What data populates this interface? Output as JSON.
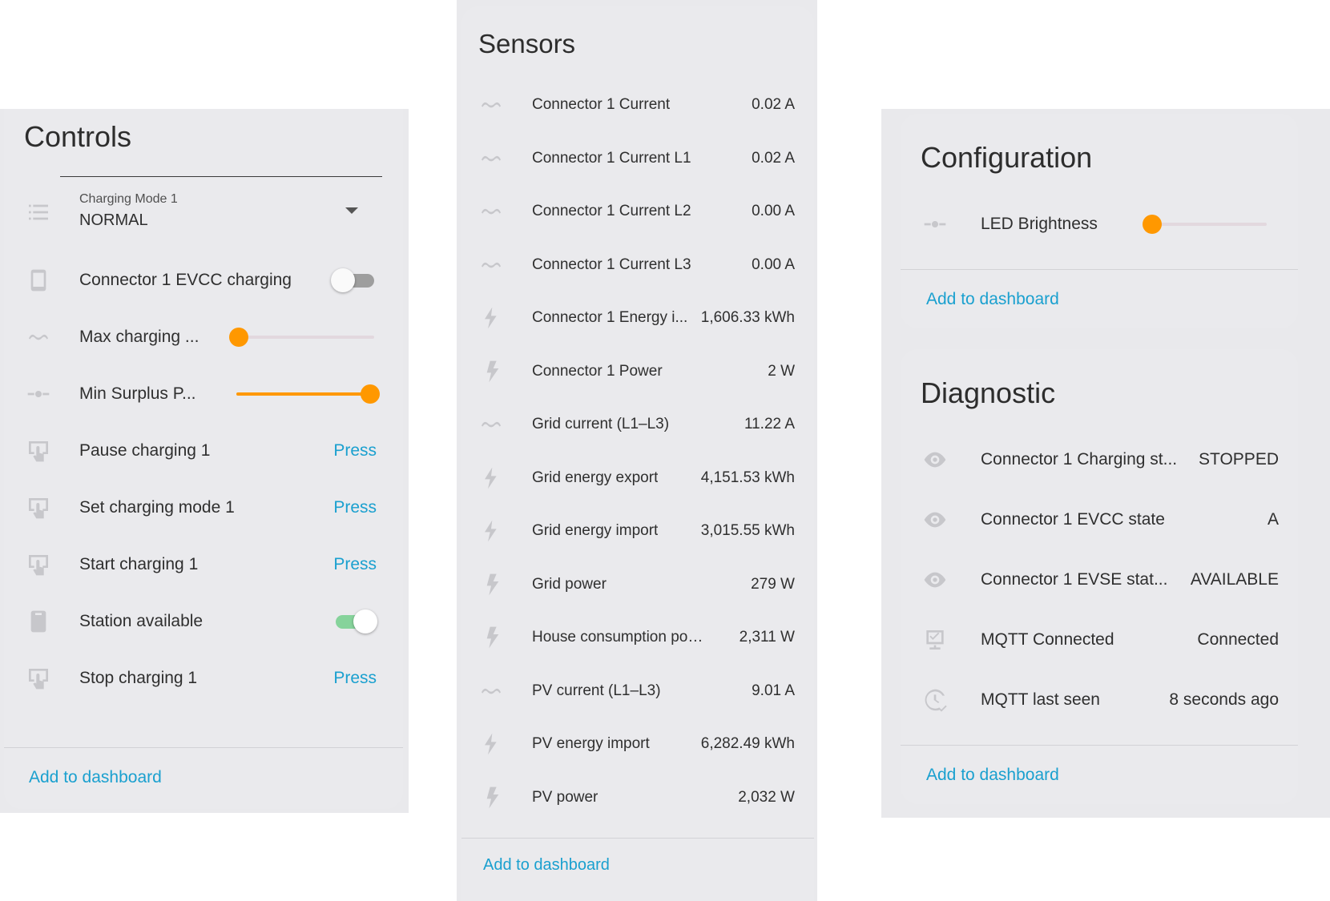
{
  "controls": {
    "title": "Controls",
    "select": {
      "label": "Charging Mode 1",
      "value": "NORMAL",
      "icon": "list-icon"
    },
    "rows": [
      {
        "label": "Connector 1 EVCC charging",
        "type": "toggle",
        "state": false,
        "icon": "phone-icon"
      },
      {
        "label": "Max charging ...",
        "type": "slider",
        "level": 0.02,
        "icon": "current-icon"
      },
      {
        "label": "Min Surplus P...",
        "type": "slider",
        "level": 1.0,
        "icon": "slider-icon"
      },
      {
        "label": "Pause charging 1",
        "type": "button",
        "button_label": "Press",
        "icon": "gesture-tap-icon"
      },
      {
        "label": "Set charging mode 1",
        "type": "button",
        "button_label": "Press",
        "icon": "gesture-tap-icon"
      },
      {
        "label": "Start charging 1",
        "type": "button",
        "button_label": "Press",
        "icon": "gesture-tap-icon"
      },
      {
        "label": "Station available",
        "type": "toggle",
        "state": true,
        "icon": "cellphone-icon"
      },
      {
        "label": "Stop charging 1",
        "type": "button",
        "button_label": "Press",
        "icon": "gesture-tap-icon"
      }
    ],
    "add_label": "Add to dashboard"
  },
  "sensors": {
    "title": "Sensors",
    "rows": [
      {
        "label": "Connector 1 Current",
        "value": "0.02 A",
        "icon": "current-ac-icon"
      },
      {
        "label": "Connector 1 Current L1",
        "value": "0.02 A",
        "icon": "current-ac-icon"
      },
      {
        "label": "Connector 1 Current L2",
        "value": "0.00 A",
        "icon": "current-ac-icon"
      },
      {
        "label": "Connector 1 Current L3",
        "value": "0.00 A",
        "icon": "current-ac-icon"
      },
      {
        "label": "Connector 1 Energy i...",
        "value": "1,606.33 kWh",
        "icon": "lightning-icon"
      },
      {
        "label": "Connector 1 Power",
        "value": "2 W",
        "icon": "flash-icon"
      },
      {
        "label": "Grid current (L1–L3)",
        "value": "11.22 A",
        "icon": "current-ac-icon"
      },
      {
        "label": "Grid energy export",
        "value": "4,151.53 kWh",
        "icon": "lightning-icon"
      },
      {
        "label": "Grid energy import",
        "value": "3,015.55 kWh",
        "icon": "lightning-icon"
      },
      {
        "label": "Grid power",
        "value": "279 W",
        "icon": "flash-icon"
      },
      {
        "label": "House consumption power",
        "value": "2,311 W",
        "icon": "flash-icon"
      },
      {
        "label": "PV current (L1–L3)",
        "value": "9.01 A",
        "icon": "current-ac-icon"
      },
      {
        "label": "PV energy import",
        "value": "6,282.49 kWh",
        "icon": "lightning-icon"
      },
      {
        "label": "PV power",
        "value": "2,032 W",
        "icon": "flash-icon"
      }
    ],
    "add_label": "Add to dashboard"
  },
  "configuration": {
    "title": "Configuration",
    "rows": [
      {
        "label": "LED Brightness",
        "type": "slider",
        "level": 0.0,
        "icon": "slider-icon"
      }
    ],
    "add_label": "Add to dashboard"
  },
  "diagnostic": {
    "title": "Diagnostic",
    "rows": [
      {
        "label": "Connector 1 Charging st...",
        "value": "STOPPED",
        "icon": "eye-icon"
      },
      {
        "label": "Connector 1 EVCC state",
        "value": "A",
        "icon": "eye-icon"
      },
      {
        "label": "Connector 1 EVSE stat...",
        "value": "AVAILABLE",
        "icon": "eye-icon"
      },
      {
        "label": "MQTT Connected",
        "value": "Connected",
        "icon": "monitor-check-icon"
      },
      {
        "label": "MQTT last seen",
        "value": "8 seconds ago",
        "icon": "clock-check-icon"
      }
    ],
    "add_label": "Add to dashboard"
  },
  "colors": {
    "accent_link": "#1aa0cf",
    "slider": "#ff9800",
    "toggle_on": "#86d39b",
    "card_bg": "#eaeaed"
  }
}
